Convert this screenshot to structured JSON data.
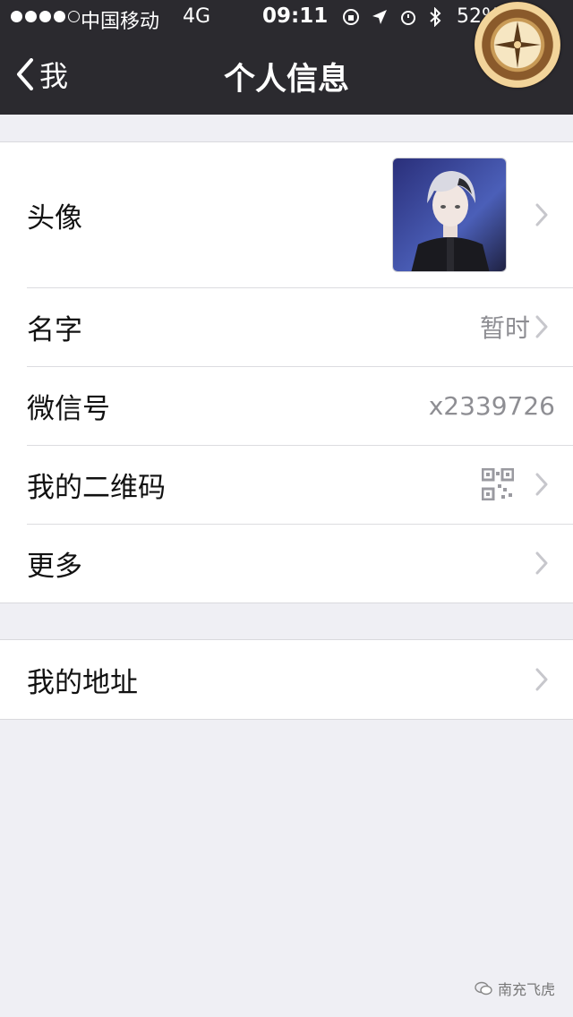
{
  "status_bar": {
    "carrier": "中国移动",
    "network": "4G",
    "time": "09:11",
    "battery_percent_text": "52%",
    "battery_level": 0.52,
    "signal_bars_filled": 4,
    "signal_bars_total": 5
  },
  "nav": {
    "back_label": "我",
    "title": "个人信息"
  },
  "profile_group": [
    {
      "label": "头像",
      "type": "avatar"
    },
    {
      "label": "名字",
      "value": "暂时"
    },
    {
      "label": "微信号",
      "value": "x2339726"
    },
    {
      "label": "我的二维码",
      "type": "qr"
    },
    {
      "label": "更多"
    }
  ],
  "address_group": [
    {
      "label": "我的地址"
    }
  ],
  "watermark": {
    "text": "南充飞虎"
  },
  "colors": {
    "nav_bg": "#2b2a2f",
    "page_bg": "#efeff4",
    "secondary_text": "#8e8e93",
    "chevron": "#c7c7cc"
  },
  "icons": [
    "back-chevron-icon",
    "chevron-right-icon",
    "qr-code-icon",
    "compass-badge-icon",
    "wechat-icon"
  ]
}
